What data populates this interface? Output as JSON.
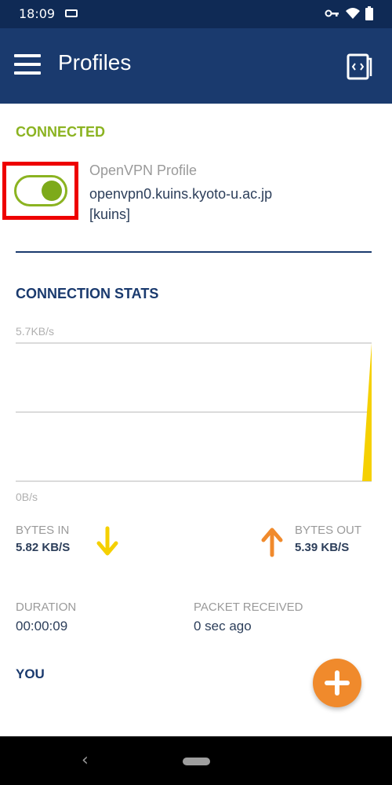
{
  "status_bar": {
    "time": "18:09",
    "icons": [
      "sim-card-icon",
      "vpn-key-icon",
      "wifi-icon",
      "battery-icon"
    ]
  },
  "app_bar": {
    "title": "Profiles",
    "menu_icon": "menu-icon",
    "action_icon": "import-profile-icon",
    "color": "#1a3a6e"
  },
  "connected_section": {
    "heading": "CONNECTED",
    "color": "#8bb321",
    "profile": {
      "name": "OpenVPN Profile",
      "server": "openvpn0.kuins.kyoto-u.ac.jp",
      "user": "[kuins]",
      "toggle_on": true
    }
  },
  "stats_section": {
    "heading": "CONNECTION STATS",
    "bytes_in_label": "BYTES IN",
    "bytes_in_value": "5.82 KB/S",
    "bytes_out_label": "BYTES OUT",
    "bytes_out_value": "5.39 KB/S",
    "duration_label": "DURATION",
    "duration_value": "00:00:09",
    "packet_label": "PACKET RECEIVED",
    "packet_value": "0 sec ago",
    "in_color": "#f5d000",
    "out_color": "#f08a2c"
  },
  "chart_data": {
    "type": "area",
    "y_max_label": "5.7KB/s",
    "y_min_label": "0B/s",
    "ylim": [
      0,
      5.7
    ],
    "grid": true,
    "series": [
      {
        "values": [
          0,
          0,
          0,
          0,
          0,
          0,
          0,
          0,
          0,
          0,
          0,
          0,
          0,
          0,
          5.7
        ]
      }
    ]
  },
  "you_section": {
    "heading": "YOU"
  },
  "fab": {
    "icon": "plus-icon",
    "color": "#f08a2c"
  },
  "nav_bar": {
    "back_icon": "‹"
  }
}
